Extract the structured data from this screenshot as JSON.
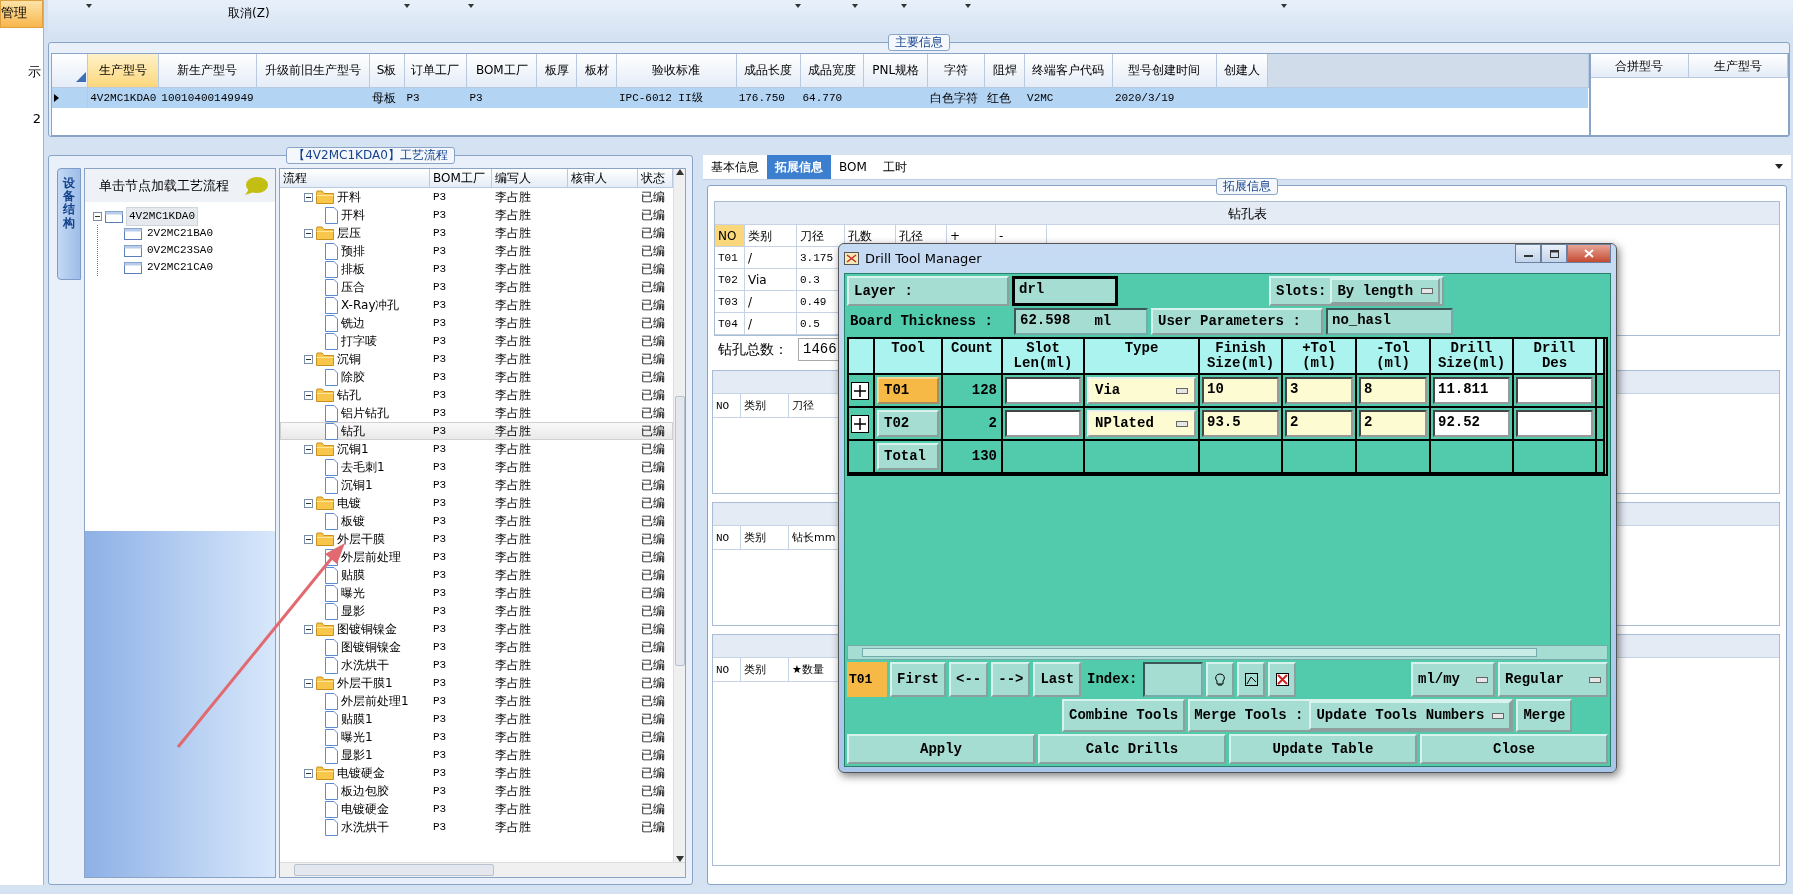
{
  "left_nav": {
    "items": [
      {
        "label": "管理",
        "selected": true
      },
      {
        "label": "示",
        "selected": false
      },
      {
        "label": "2",
        "selected": false
      }
    ]
  },
  "toolbar": {
    "items": [
      {
        "kind": "dropdown"
      },
      {
        "kind": "text",
        "label": "取消(Z)"
      },
      {
        "kind": "dropdown"
      },
      {
        "kind": "dropdown"
      },
      {
        "kind": "dropdown"
      },
      {
        "kind": "dropdown"
      },
      {
        "kind": "dropdown"
      },
      {
        "kind": "dropdown"
      },
      {
        "kind": "dropdown"
      }
    ]
  },
  "main_info": {
    "title": "主要信息",
    "columns": [
      {
        "label": "生产型号",
        "active": true
      },
      {
        "label": "新生产型号",
        "active": false
      },
      {
        "label": "升级前旧生产型号",
        "active": false
      },
      {
        "label": "S板",
        "active": false
      },
      {
        "label": "订单工厂",
        "active": false
      },
      {
        "label": "BOM工厂",
        "active": false
      },
      {
        "label": "板厚",
        "active": false
      },
      {
        "label": "板材",
        "active": false
      },
      {
        "label": "验收标准",
        "active": false
      },
      {
        "label": "成品长度",
        "active": false
      },
      {
        "label": "成品宽度",
        "active": false
      },
      {
        "label": "PNL规格",
        "active": false
      },
      {
        "label": "字符",
        "active": false
      },
      {
        "label": "阻焊",
        "active": false
      },
      {
        "label": "终端客户代码",
        "active": false
      },
      {
        "label": "型号创建时间",
        "active": false
      },
      {
        "label": "创建人",
        "active": false
      }
    ],
    "rows": [
      {
        "selected": true,
        "cells": [
          "4V2MC1KDA0",
          "10010400149949",
          null,
          "母板",
          "P3",
          "P3",
          null,
          null,
          "IPC-6012 II级",
          "176.750",
          "64.770",
          null,
          "白色字符",
          "红色",
          "V2MC",
          "2020/3/19",
          null
        ]
      }
    ]
  },
  "merge_panel": {
    "columns": [
      "合拼型号",
      "生产型号"
    ]
  },
  "process": {
    "title": "【4V2MC1KDA0】工艺流程",
    "side_tab": "设备结构",
    "tree_header": "单击节点加载工艺流程",
    "tree": [
      {
        "label": "4V2MC1KDA0",
        "selected": true,
        "expanded": true,
        "children": [
          {
            "label": "2V2MC21BA0",
            "selected": false
          },
          {
            "label": "0V2MC23SA0",
            "selected": false
          },
          {
            "label": "2V2MC21CA0",
            "selected": false
          }
        ]
      }
    ],
    "columns": [
      "流程",
      "BOM工厂",
      "编写人",
      "核审人",
      "状态"
    ],
    "rows": [
      {
        "name": "开料",
        "factory": "P3",
        "writer": "李占胜",
        "status": "已编",
        "selected": false,
        "expanded": true,
        "children": [
          {
            "name": "开料",
            "factory": "P3",
            "writer": "李占胜",
            "status": "已编",
            "selected": false
          }
        ]
      },
      {
        "name": "层压",
        "factory": "P3",
        "writer": "李占胜",
        "status": "已编",
        "selected": false,
        "expanded": true,
        "children": [
          {
            "name": "预排",
            "factory": "P3",
            "writer": "李占胜",
            "status": "已编",
            "selected": false
          },
          {
            "name": "排板",
            "factory": "P3",
            "writer": "李占胜",
            "status": "已编",
            "selected": false
          },
          {
            "name": "压合",
            "factory": "P3",
            "writer": "李占胜",
            "status": "已编",
            "selected": false
          },
          {
            "name": "X-Ray冲孔",
            "factory": "P3",
            "writer": "李占胜",
            "status": "已编",
            "selected": false
          },
          {
            "name": "铣边",
            "factory": "P3",
            "writer": "李占胜",
            "status": "已编",
            "selected": false
          },
          {
            "name": "打字唛",
            "factory": "P3",
            "writer": "李占胜",
            "status": "已编",
            "selected": false
          }
        ]
      },
      {
        "name": "沉铜",
        "factory": "P3",
        "writer": "李占胜",
        "status": "已编",
        "selected": false,
        "expanded": true,
        "children": [
          {
            "name": "除胶",
            "factory": "P3",
            "writer": "李占胜",
            "status": "已编",
            "selected": false
          }
        ]
      },
      {
        "name": "钻孔",
        "factory": "P3",
        "writer": "李占胜",
        "status": "已编",
        "selected": false,
        "expanded": true,
        "children": [
          {
            "name": "铝片钻孔",
            "factory": "P3",
            "writer": "李占胜",
            "status": "已编",
            "selected": false
          },
          {
            "name": "钻孔",
            "factory": "P3",
            "writer": "李占胜",
            "status": "已编",
            "selected": true
          }
        ]
      },
      {
        "name": "沉铜1",
        "factory": "P3",
        "writer": "李占胜",
        "status": "已编",
        "selected": false,
        "expanded": true,
        "children": [
          {
            "name": "去毛刺1",
            "factory": "P3",
            "writer": "李占胜",
            "status": "已编",
            "selected": false
          },
          {
            "name": "沉铜1",
            "factory": "P3",
            "writer": "李占胜",
            "status": "已编",
            "selected": false
          }
        ]
      },
      {
        "name": "电镀",
        "factory": "P3",
        "writer": "李占胜",
        "status": "已编",
        "selected": false,
        "expanded": true,
        "children": [
          {
            "name": "板镀",
            "factory": "P3",
            "writer": "李占胜",
            "status": "已编",
            "selected": false
          }
        ]
      },
      {
        "name": "外层干膜",
        "factory": "P3",
        "writer": "李占胜",
        "status": "已编",
        "selected": false,
        "expanded": true,
        "children": [
          {
            "name": "外层前处理",
            "factory": "P3",
            "writer": "李占胜",
            "status": "已编",
            "selected": false
          },
          {
            "name": "贴膜",
            "factory": "P3",
            "writer": "李占胜",
            "status": "已编",
            "selected": false
          },
          {
            "name": "曝光",
            "factory": "P3",
            "writer": "李占胜",
            "status": "已编",
            "selected": false
          },
          {
            "name": "显影",
            "factory": "P3",
            "writer": "李占胜",
            "status": "已编",
            "selected": false
          }
        ]
      },
      {
        "name": "图镀铜镍金",
        "factory": "P3",
        "writer": "李占胜",
        "status": "已编",
        "selected": false,
        "expanded": true,
        "children": [
          {
            "name": "图镀铜镍金",
            "factory": "P3",
            "writer": "李占胜",
            "status": "已编",
            "selected": false
          },
          {
            "name": "水洗烘干",
            "factory": "P3",
            "writer": "李占胜",
            "status": "已编",
            "selected": false
          }
        ]
      },
      {
        "name": "外层干膜1",
        "factory": "P3",
        "writer": "李占胜",
        "status": "已编",
        "selected": false,
        "expanded": true,
        "children": [
          {
            "name": "外层前处理1",
            "factory": "P3",
            "writer": "李占胜",
            "status": "已编",
            "selected": false
          },
          {
            "name": "贴膜1",
            "factory": "P3",
            "writer": "李占胜",
            "status": "已编",
            "selected": false
          },
          {
            "name": "曝光1",
            "factory": "P3",
            "writer": "李占胜",
            "status": "已编",
            "selected": false
          },
          {
            "name": "显影1",
            "factory": "P3",
            "writer": "李占胜",
            "status": "已编",
            "selected": false
          }
        ]
      },
      {
        "name": "电镀硬金",
        "factory": "P3",
        "writer": "李占胜",
        "status": "已编",
        "selected": false,
        "expanded": true,
        "children": [
          {
            "name": "板边包胶",
            "factory": "P3",
            "writer": "李占胜",
            "status": "已编",
            "selected": false
          },
          {
            "name": "电镀硬金",
            "factory": "P3",
            "writer": "李占胜",
            "status": "已编",
            "selected": false
          },
          {
            "name": "水洗烘干",
            "factory": "P3",
            "writer": "李占胜",
            "status": "已编",
            "selected": false
          }
        ]
      }
    ]
  },
  "tabs": [
    {
      "label": "基本信息",
      "selected": false
    },
    {
      "label": "拓展信息",
      "selected": true
    },
    {
      "label": "BOM",
      "selected": false
    },
    {
      "label": "工时",
      "selected": false
    }
  ],
  "extended": {
    "title": "拓展信息",
    "drill_table": {
      "title": "钻孔表",
      "columns": [
        {
          "label": "NO",
          "active": true
        },
        {
          "label": "类别",
          "active": false
        },
        {
          "label": "刀径",
          "active": false
        },
        {
          "label": "孔数",
          "active": false
        },
        {
          "label": "孔径",
          "active": false
        },
        {
          "label": "+",
          "active": false
        },
        {
          "label": "-",
          "active": false
        }
      ],
      "rows": [
        [
          "T01",
          "/",
          "3.175"
        ],
        [
          "T02",
          "Via",
          "0.3"
        ],
        [
          "T03",
          "/",
          "0.49"
        ],
        [
          "T04",
          "/",
          "0.5"
        ]
      ]
    },
    "total_label": "钻孔总数：",
    "total_value": "1466",
    "sub_grids": [
      {
        "columns": [
          "NO",
          "类别",
          "刀径"
        ]
      },
      {
        "columns": [
          "NO",
          "类别",
          "钻长mm"
        ]
      },
      {
        "columns": [
          "NO",
          "类别",
          "★数量"
        ]
      }
    ]
  },
  "dialog": {
    "title": "Drill Tool Manager",
    "layer": {
      "label": "Layer :",
      "value": "drl"
    },
    "slots": {
      "label": "Slots:",
      "value": "By length"
    },
    "board_thickness": {
      "label": "Board Thickness :",
      "value": "62.598",
      "unit": "ml"
    },
    "user_parameters": {
      "label": "User Parameters :",
      "value": "no_hasl"
    },
    "columns": [
      "Tool",
      "Count",
      "Slot\nLen(ml)",
      "Type",
      "Finish\nSize(ml)",
      "+Tol\n(ml)",
      "-Tol\n(ml)",
      "Drill\nSize(ml)",
      "Drill\nDes"
    ],
    "tools": [
      {
        "tool": "T01",
        "selected": true,
        "count": "128",
        "type": "Via",
        "finish": "10",
        "plus_tol": "3",
        "minus_tol": "8",
        "drill": "11.811"
      },
      {
        "tool": "T02",
        "selected": false,
        "count": "2",
        "type": "NPlated",
        "finish": "93.5",
        "plus_tol": "2",
        "minus_tol": "2",
        "drill": "92.52"
      }
    ],
    "total": {
      "label": "Total",
      "count": "130"
    },
    "current": "T01",
    "nav_buttons": [
      "First",
      "<--",
      "-->",
      "Last"
    ],
    "index_label": "Index:",
    "units": "ml/my",
    "mode": "Regular",
    "combine": "Combine Tools",
    "merge_label": "Merge Tools :",
    "merge_option": "Update Tools Numbers",
    "merge": "Merge",
    "actions": [
      "Apply",
      "Calc Drills",
      "Update Table",
      "Close"
    ]
  }
}
